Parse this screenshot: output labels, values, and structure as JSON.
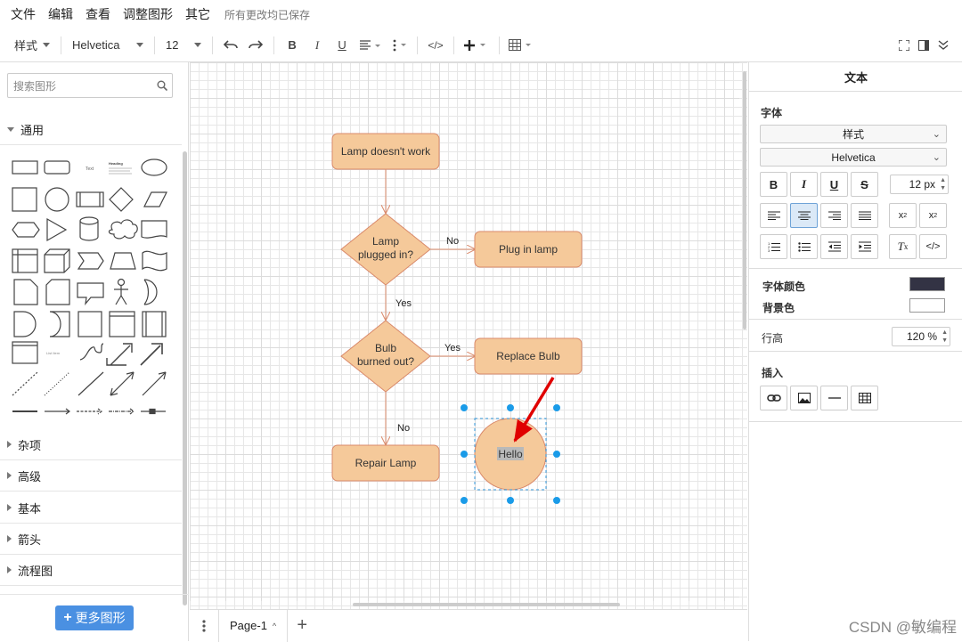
{
  "menu": {
    "items": [
      "文件",
      "编辑",
      "查看",
      "调整图形",
      "其它"
    ],
    "saved_status": "所有更改均已保存"
  },
  "toolbar": {
    "style_label": "样式",
    "font_label": "Helvetica",
    "size_label": "12"
  },
  "left": {
    "search_placeholder": "搜索图形",
    "general": "通用",
    "sections": [
      "杂项",
      "高级",
      "基本",
      "箭头",
      "流程图"
    ],
    "more_shapes": "更多图形",
    "thumb_text": "Text",
    "thumb_heading": "Heading",
    "thumb_list": "List Item"
  },
  "diagram": {
    "node_start": "Lamp doesn't work",
    "node_q1_line1": "Lamp",
    "node_q1_line2": "plugged in?",
    "node_plug": "Plug in lamp",
    "node_q2_line1": "Bulb",
    "node_q2_line2": "burned out?",
    "node_replace": "Replace Bulb",
    "node_repair": "Repair Lamp",
    "node_hello": "Hello",
    "edge_no1": "No",
    "edge_yes1": "Yes",
    "edge_yes2": "Yes",
    "edge_no2": "No",
    "fill_color": "#f5c99a",
    "stroke_color": "#d9896a"
  },
  "bottom": {
    "page_tab": "Page-1"
  },
  "right": {
    "title": "文本",
    "font_section": "字体",
    "style_dropdown": "样式",
    "font_dropdown": "Helvetica",
    "font_size": "12 px",
    "font_color_label": "字体颜色",
    "bg_color_label": "背景色",
    "font_color": "#333344",
    "bg_color": "#ffffff",
    "line_height_label": "行高",
    "line_height": "120 %",
    "insert_label": "插入"
  },
  "watermark": "CSDN @敏编程"
}
